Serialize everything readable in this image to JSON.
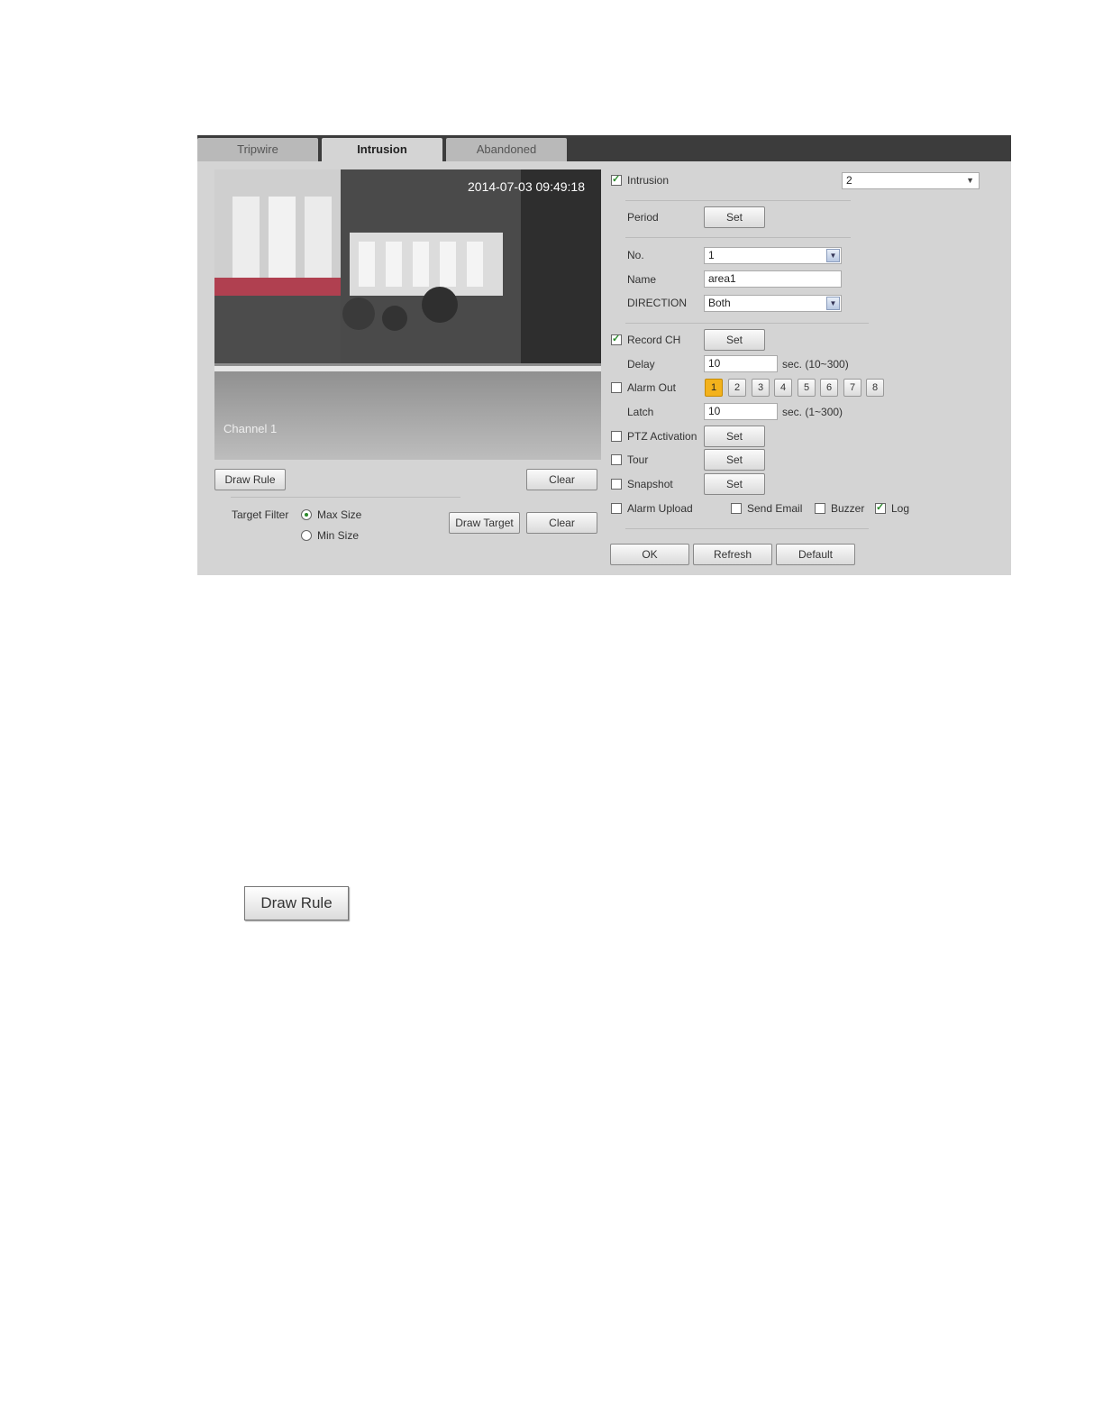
{
  "tabs": [
    {
      "label": "Tripwire",
      "active": false
    },
    {
      "label": "Intrusion",
      "active": true
    },
    {
      "label": "Abandoned",
      "active": false
    }
  ],
  "video": {
    "timestamp": "2014-07-03 09:49:18",
    "channel_label": "Channel 1"
  },
  "left_buttons": {
    "draw_rule": "Draw Rule",
    "clear_rule": "Clear",
    "draw_target": "Draw Target",
    "clear_target": "Clear"
  },
  "target_filter": {
    "label": "Target Filter",
    "options": [
      "Max Size",
      "Min Size"
    ],
    "selected": "Max Size"
  },
  "settings": {
    "intrusion_label": "Intrusion",
    "intrusion_checked": true,
    "channel_value": "2",
    "period_label": "Period",
    "set_label": "Set",
    "no_label": "No.",
    "no_value": "1",
    "name_label": "Name",
    "name_value": "area1",
    "direction_label": "DIRECTION",
    "direction_value": "Both",
    "record_ch_label": "Record CH",
    "record_ch_checked": true,
    "delay_label": "Delay",
    "delay_value": "10",
    "delay_hint": "sec. (10~300)",
    "alarm_out_label": "Alarm Out",
    "alarm_out_checked": false,
    "alarm_channels": [
      "1",
      "2",
      "3",
      "4",
      "5",
      "6",
      "7",
      "8"
    ],
    "alarm_channel_selected": "1",
    "latch_label": "Latch",
    "latch_value": "10",
    "latch_hint": "sec. (1~300)",
    "ptz_label": "PTZ Activation",
    "ptz_checked": false,
    "tour_label": "Tour",
    "tour_checked": false,
    "snapshot_label": "Snapshot",
    "snapshot_checked": false,
    "alarm_upload_label": "Alarm Upload",
    "alarm_upload_checked": false,
    "send_email_label": "Send Email",
    "send_email_checked": false,
    "buzzer_label": "Buzzer",
    "buzzer_checked": false,
    "log_label": "Log",
    "log_checked": true
  },
  "footer_buttons": {
    "ok": "OK",
    "refresh": "Refresh",
    "default": "Default"
  },
  "standalone_button": "Draw Rule",
  "colors": {
    "panel_bg": "#d4d4d4",
    "tab_bar": "#3c3c3c",
    "alarm_selected": "#f3b21c"
  }
}
